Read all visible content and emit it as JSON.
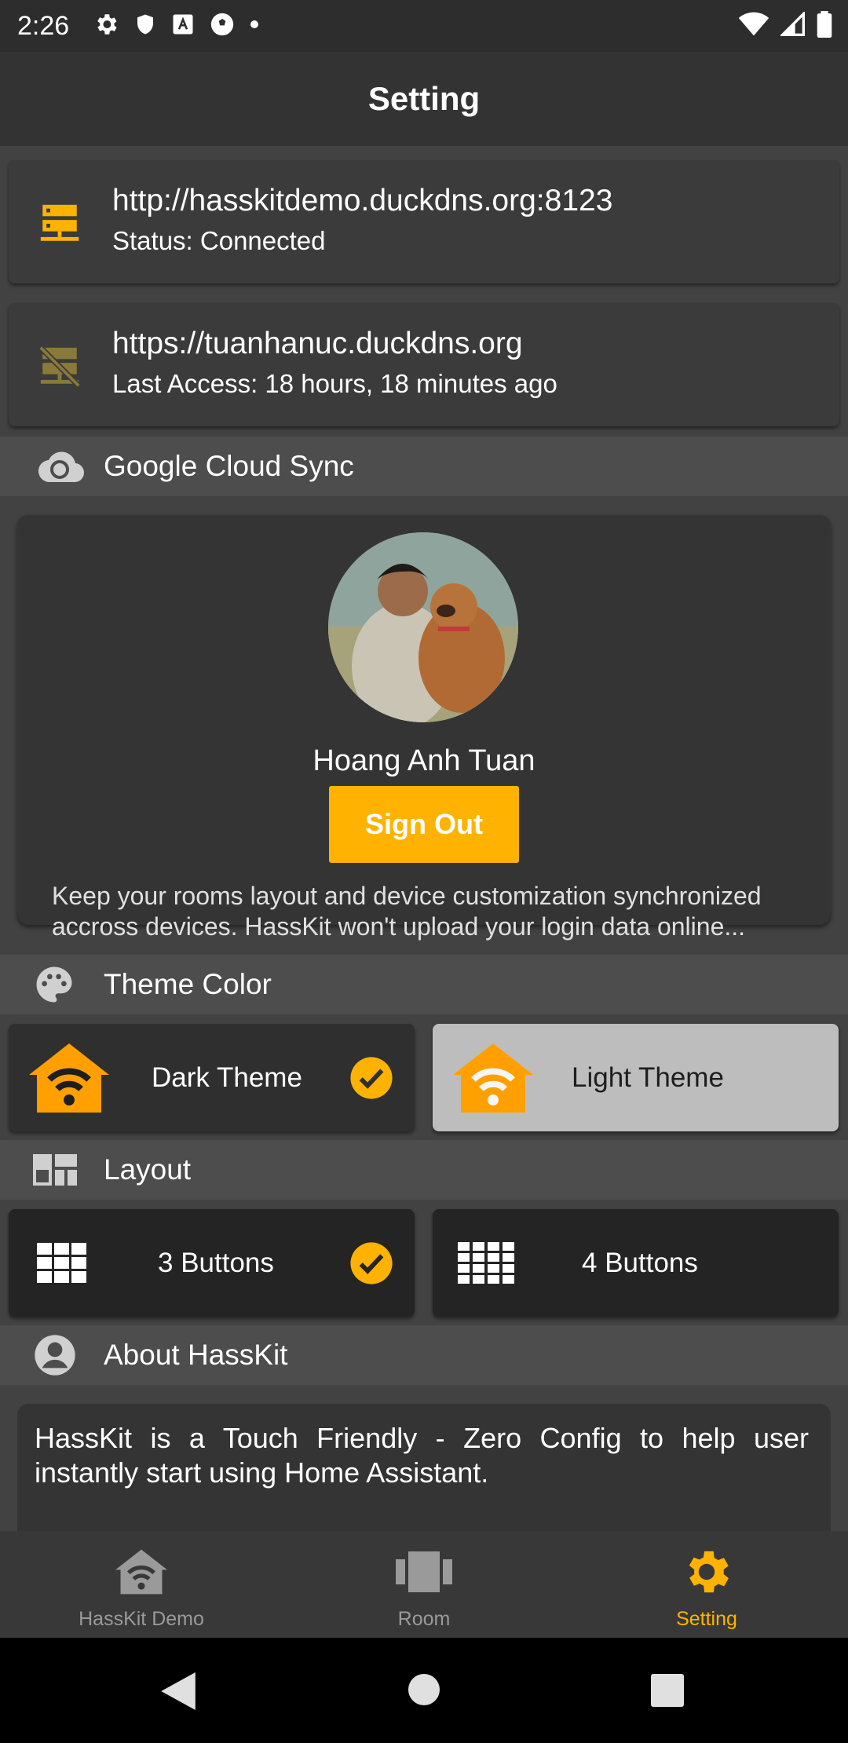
{
  "status_bar": {
    "time": "2:26"
  },
  "app_bar": {
    "title": "Setting"
  },
  "servers": [
    {
      "url": "http://hasskitdemo.duckdns.org:8123",
      "sub": "Status: Connected",
      "icon": "server-connected-icon"
    },
    {
      "url": "https://tuanhanuc.duckdns.org",
      "sub": "Last Access: 18 hours, 18 minutes ago",
      "icon": "server-off-icon"
    }
  ],
  "google_sync": {
    "header": "Google Cloud Sync",
    "user_name": "Hoang Anh Tuan",
    "sign_out_label": "Sign Out",
    "description": "Keep your rooms layout and device customization synchronized accross devices. HassKit won't upload your login data online..."
  },
  "theme": {
    "header": "Theme Color",
    "dark_label": "Dark Theme",
    "light_label": "Light Theme",
    "selected": "dark"
  },
  "layout": {
    "header": "Layout",
    "three_label": "3 Buttons",
    "four_label": "4 Buttons",
    "selected": "3"
  },
  "about": {
    "header": "About HassKit",
    "text": "HassKit is a Touch Friendly - Zero Config to help user instantly start using  Home Assistant."
  },
  "bottom_nav": {
    "items": [
      {
        "label": "HassKit Demo",
        "icon": "home-wifi-icon"
      },
      {
        "label": "Room",
        "icon": "room-icon"
      },
      {
        "label": "Setting",
        "icon": "gear-icon",
        "active": true
      }
    ]
  },
  "colors": {
    "accent": "#ffb300",
    "background": "#424242",
    "appbar": "#333333"
  }
}
